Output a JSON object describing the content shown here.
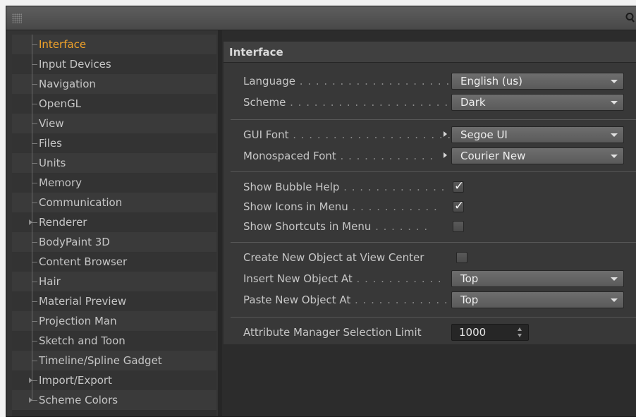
{
  "sidebar": {
    "items": [
      {
        "label": "Interface",
        "selected": true,
        "expandable": false
      },
      {
        "label": "Input Devices",
        "selected": false,
        "expandable": false
      },
      {
        "label": "Navigation",
        "selected": false,
        "expandable": false
      },
      {
        "label": "OpenGL",
        "selected": false,
        "expandable": false
      },
      {
        "label": "View",
        "selected": false,
        "expandable": false
      },
      {
        "label": "Files",
        "selected": false,
        "expandable": false
      },
      {
        "label": "Units",
        "selected": false,
        "expandable": false
      },
      {
        "label": "Memory",
        "selected": false,
        "expandable": false
      },
      {
        "label": "Communication",
        "selected": false,
        "expandable": false
      },
      {
        "label": "Renderer",
        "selected": false,
        "expandable": true
      },
      {
        "label": "BodyPaint 3D",
        "selected": false,
        "expandable": false
      },
      {
        "label": "Content Browser",
        "selected": false,
        "expandable": false
      },
      {
        "label": "Hair",
        "selected": false,
        "expandable": false
      },
      {
        "label": "Material Preview",
        "selected": false,
        "expandable": false
      },
      {
        "label": "Projection Man",
        "selected": false,
        "expandable": false
      },
      {
        "label": "Sketch and Toon",
        "selected": false,
        "expandable": false
      },
      {
        "label": "Timeline/Spline Gadget",
        "selected": false,
        "expandable": false
      },
      {
        "label": "Import/Export",
        "selected": false,
        "expandable": true
      },
      {
        "label": "Scheme Colors",
        "selected": false,
        "expandable": true
      }
    ]
  },
  "panel": {
    "title": "Interface",
    "language": {
      "label": "Language",
      "dots": " . . . . . . . . . . . . . . . . . . . . . . .",
      "value": "English (us)"
    },
    "scheme": {
      "label": "Scheme",
      "dots": " . . . . . . . . . . . . . . . . . . . . . . . . .",
      "value": "Dark"
    },
    "gui_font": {
      "label": "GUI Font",
      "dots": " . . . . . . . . . . . . . . . . . . . . . .",
      "value": "Segoe UI"
    },
    "mono_font": {
      "label": "Monospaced Font",
      "dots": " . . . . . . . . . . . .",
      "value": "Courier New"
    },
    "bubble_help": {
      "label": "Show Bubble Help",
      "dots": " . . . . . . . . . . . . .",
      "checked": true
    },
    "icons_in_menu": {
      "label": "Show Icons in Menu",
      "dots": " . . . . . . . . . . .",
      "checked": true
    },
    "shortcuts_in_menu": {
      "label": "Show Shortcuts in Menu",
      "dots": " . . . . . . .",
      "checked": false
    },
    "create_at_center": {
      "label": "Create New Object at View Center",
      "checked": false
    },
    "insert_at": {
      "label": "Insert New Object At",
      "dots": " . . . . . . . . . . .",
      "value": "Top"
    },
    "paste_at": {
      "label": "Paste New Object At",
      "dots": " . . . . . . . . . . . .",
      "value": "Top"
    },
    "selection_limit": {
      "label": "Attribute Manager Selection Limit",
      "value": "1000"
    }
  },
  "icons": {
    "grip": "grip-icon",
    "search": "search-icon",
    "check": "✓"
  },
  "colors": {
    "selected_text": "#f0a22a",
    "background": "#383838"
  }
}
